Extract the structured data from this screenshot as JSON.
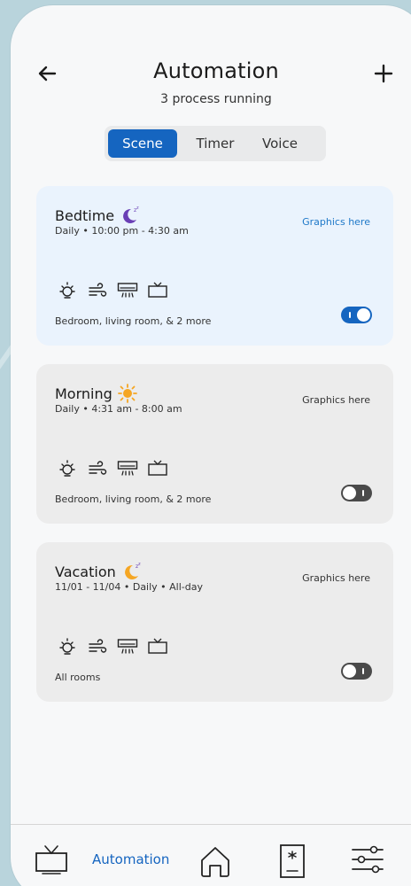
{
  "header": {
    "title": "Automation",
    "subtitle": "3 process running"
  },
  "tabs": [
    {
      "label": "Scene",
      "active": true
    },
    {
      "label": "Timer",
      "active": false
    },
    {
      "label": "Voice",
      "active": false
    }
  ],
  "cards": [
    {
      "name": "Bedtime",
      "icon": "moon-icon",
      "schedule": "Daily • 10:00 pm - 4:30 am",
      "graphic_label": "Graphics here",
      "rooms": "Bedroom, living room, & 2 more",
      "enabled": true
    },
    {
      "name": "Morning",
      "icon": "sun-icon",
      "schedule": "Daily • 4:31 am - 8:00 am",
      "graphic_label": "Graphics here",
      "rooms": "Bedroom, living room, & 2 more",
      "enabled": false
    },
    {
      "name": "Vacation",
      "icon": "moon-icon",
      "schedule": "11/01 - 11/04 • Daily • All-day",
      "graphic_label": "Graphics here",
      "rooms": "All rooms",
      "enabled": false
    }
  ],
  "device_icons": [
    "light-bulb-icon",
    "fan-icon",
    "air-conditioner-icon",
    "tv-icon"
  ],
  "bottom_nav": {
    "active_label": "Automation"
  },
  "colors": {
    "accent": "#1565c0",
    "moon": "#6a3fb5",
    "sun": "#f5a623",
    "active_card": "#eaf3fd",
    "inactive_card": "#ececec"
  }
}
